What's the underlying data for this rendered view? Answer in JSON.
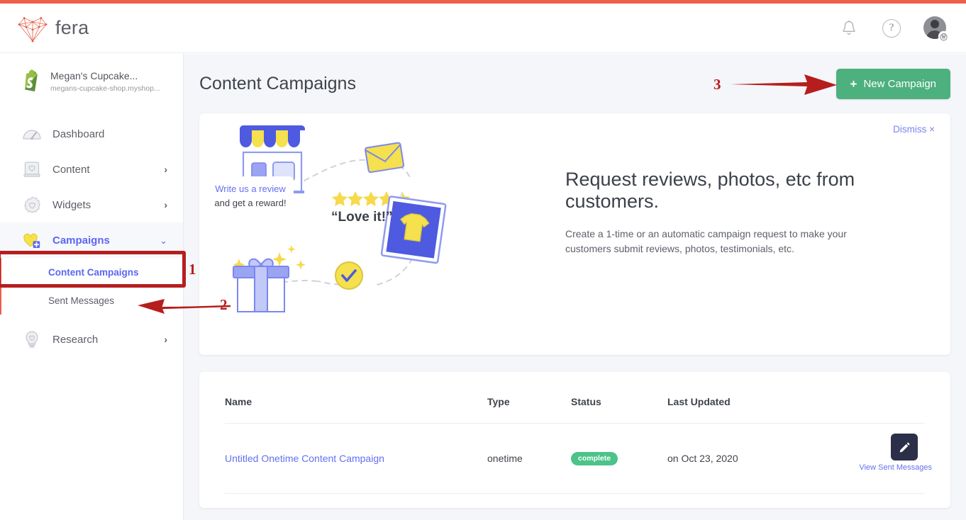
{
  "theme": {
    "accent_red": "#ec5f4c",
    "brand_purple": "#5a67f2",
    "green_button": "#4cb07f",
    "badge_green": "#4cc389",
    "annotation_red": "#b61e1e",
    "page_bg": "#f5f6f9",
    "dark_button": "#2b2f48"
  },
  "header": {
    "brand_name": "fera",
    "logo_icon": "geometric-heart-logo",
    "notifications_icon": "bell-icon",
    "help_icon": "question-mark-icon",
    "help_glyph": "?",
    "account_icon": "user-avatar-with-gear"
  },
  "sidebar": {
    "store": {
      "icon": "shopify-bag-icon",
      "name": "Megan's Cupcake...",
      "url": "megans-cupcake-shop.myshop..."
    },
    "items": [
      {
        "label": "Dashboard",
        "icon": "speedometer-icon",
        "chevron": "",
        "active": false
      },
      {
        "label": "Content",
        "icon": "book-heart-icon",
        "chevron": "›",
        "active": false
      },
      {
        "label": "Widgets",
        "icon": "badge-heart-icon",
        "chevron": "›",
        "active": false
      },
      {
        "label": "Campaigns",
        "icon": "heart-plus-icon",
        "chevron": "⌄",
        "active": true
      },
      {
        "label": "Research",
        "icon": "lightbulb-heart-icon",
        "chevron": "›",
        "active": false
      }
    ],
    "subitems": [
      {
        "label": "Content Campaigns",
        "current": true
      },
      {
        "label": "Sent Messages",
        "current": false
      }
    ]
  },
  "main": {
    "page_title": "Content Campaigns",
    "new_campaign_button": "New Campaign",
    "new_campaign_plus": "+",
    "promo": {
      "dismiss_label": "Dismiss ×",
      "title": "Request reviews, photos, etc from customers.",
      "subtitle": "Create a 1-time or an automatic campaign request to make your customers submit reviews, photos, testimonials, etc.",
      "illustration": {
        "bubble_line1": "Write us a review",
        "bubble_line2": "and get a reward!",
        "review_quote": "“Love it!”",
        "stars_filled": 4,
        "stars_half": 1,
        "stars_total": 5,
        "icons": [
          "storefront-icon",
          "envelope-icon",
          "review-card",
          "tshirt-photo",
          "gift-box-icon",
          "check-circle-icon",
          "sparkle-icon"
        ]
      }
    },
    "table": {
      "columns": [
        "Name",
        "Type",
        "Status",
        "Last Updated",
        ""
      ],
      "rows": [
        {
          "name": "Untitled Onetime Content Campaign",
          "type": "onetime",
          "status": "complete",
          "last_updated": "on Oct 23, 2020",
          "action_icon": "pencil-edit-icon",
          "action_link": "View Sent Messages"
        }
      ]
    }
  },
  "annotations": [
    {
      "number": "1",
      "target": "campaigns-nav-item",
      "style": "box-with-number"
    },
    {
      "number": "2",
      "target": "content-campaigns-subnav",
      "style": "arrow-left"
    },
    {
      "number": "3",
      "target": "new-campaign-button",
      "style": "arrow-right"
    }
  ]
}
